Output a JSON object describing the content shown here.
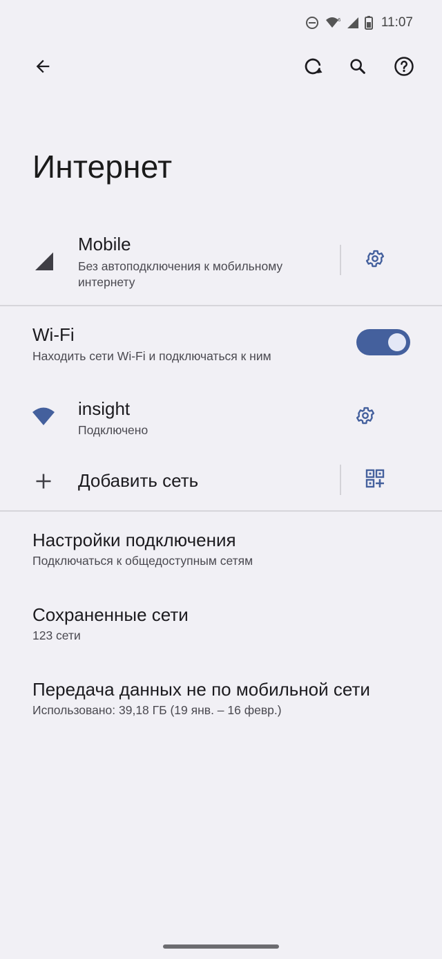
{
  "status_bar": {
    "time": "11:07",
    "icons": [
      "dnd-icon",
      "wifi-icon",
      "signal-icon",
      "battery-icon"
    ]
  },
  "toolbar": {
    "back_icon": "arrow-back-icon",
    "actions": [
      "refresh-icon",
      "search-icon",
      "help-icon"
    ]
  },
  "page": {
    "title": "Интернет"
  },
  "mobile": {
    "title": "Mobile",
    "subtitle": "Без автоподключения к мобильному интернету",
    "icon": "cell-signal-icon",
    "settings_icon": "gear-icon"
  },
  "wifi": {
    "title": "Wi-Fi",
    "subtitle": "Находить сети Wi-Fi и подключаться к ним",
    "enabled": true
  },
  "network": {
    "name": "insight",
    "status": "Подключено",
    "icon": "wifi-icon",
    "settings_icon": "gear-icon"
  },
  "add_network": {
    "label": "Добавить сеть",
    "icon": "plus-icon",
    "qr_icon": "qr-add-icon"
  },
  "connection_settings": {
    "title": "Настройки подключения",
    "subtitle": "Подключаться к общедоступным сетям"
  },
  "saved_networks": {
    "title": "Сохраненные сети",
    "subtitle": "123 сети"
  },
  "non_mobile_data": {
    "title": "Передача данных не по мобильной сети",
    "subtitle": "Использовано: 39,18 ГБ (19 янв. – 16 февр.)"
  },
  "colors": {
    "accent": "#44609d",
    "background": "#f1f0f5",
    "divider": "#d6d5da",
    "text_primary": "#1c1b1f",
    "text_secondary": "#4a4950"
  }
}
